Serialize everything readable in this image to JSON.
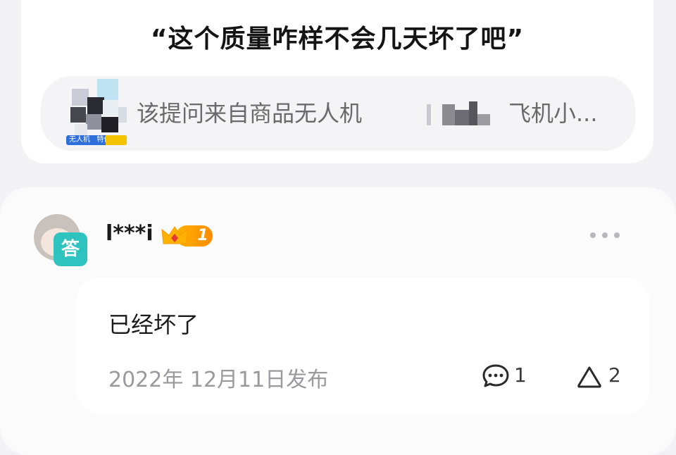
{
  "question": {
    "title": "“这个质量咋样不会几天坏了吧”",
    "source_prefix": "该提问来自商品无人机",
    "source_suffix": "飞机小...",
    "thumb_tag": "无人机   特价"
  },
  "answer": {
    "avatar_badge": "答",
    "username": "l***i",
    "level": "1",
    "text": "已经坏了",
    "date": "2022年 12月11日发布",
    "comments": "1",
    "likes": "2"
  },
  "colors": {
    "badge": "#2fc3c0",
    "level_badge": "#ff9800",
    "muted_text": "#9a9a9e"
  },
  "icons": [
    "more-icon",
    "comment-icon",
    "like-icon",
    "crown-icon"
  ]
}
